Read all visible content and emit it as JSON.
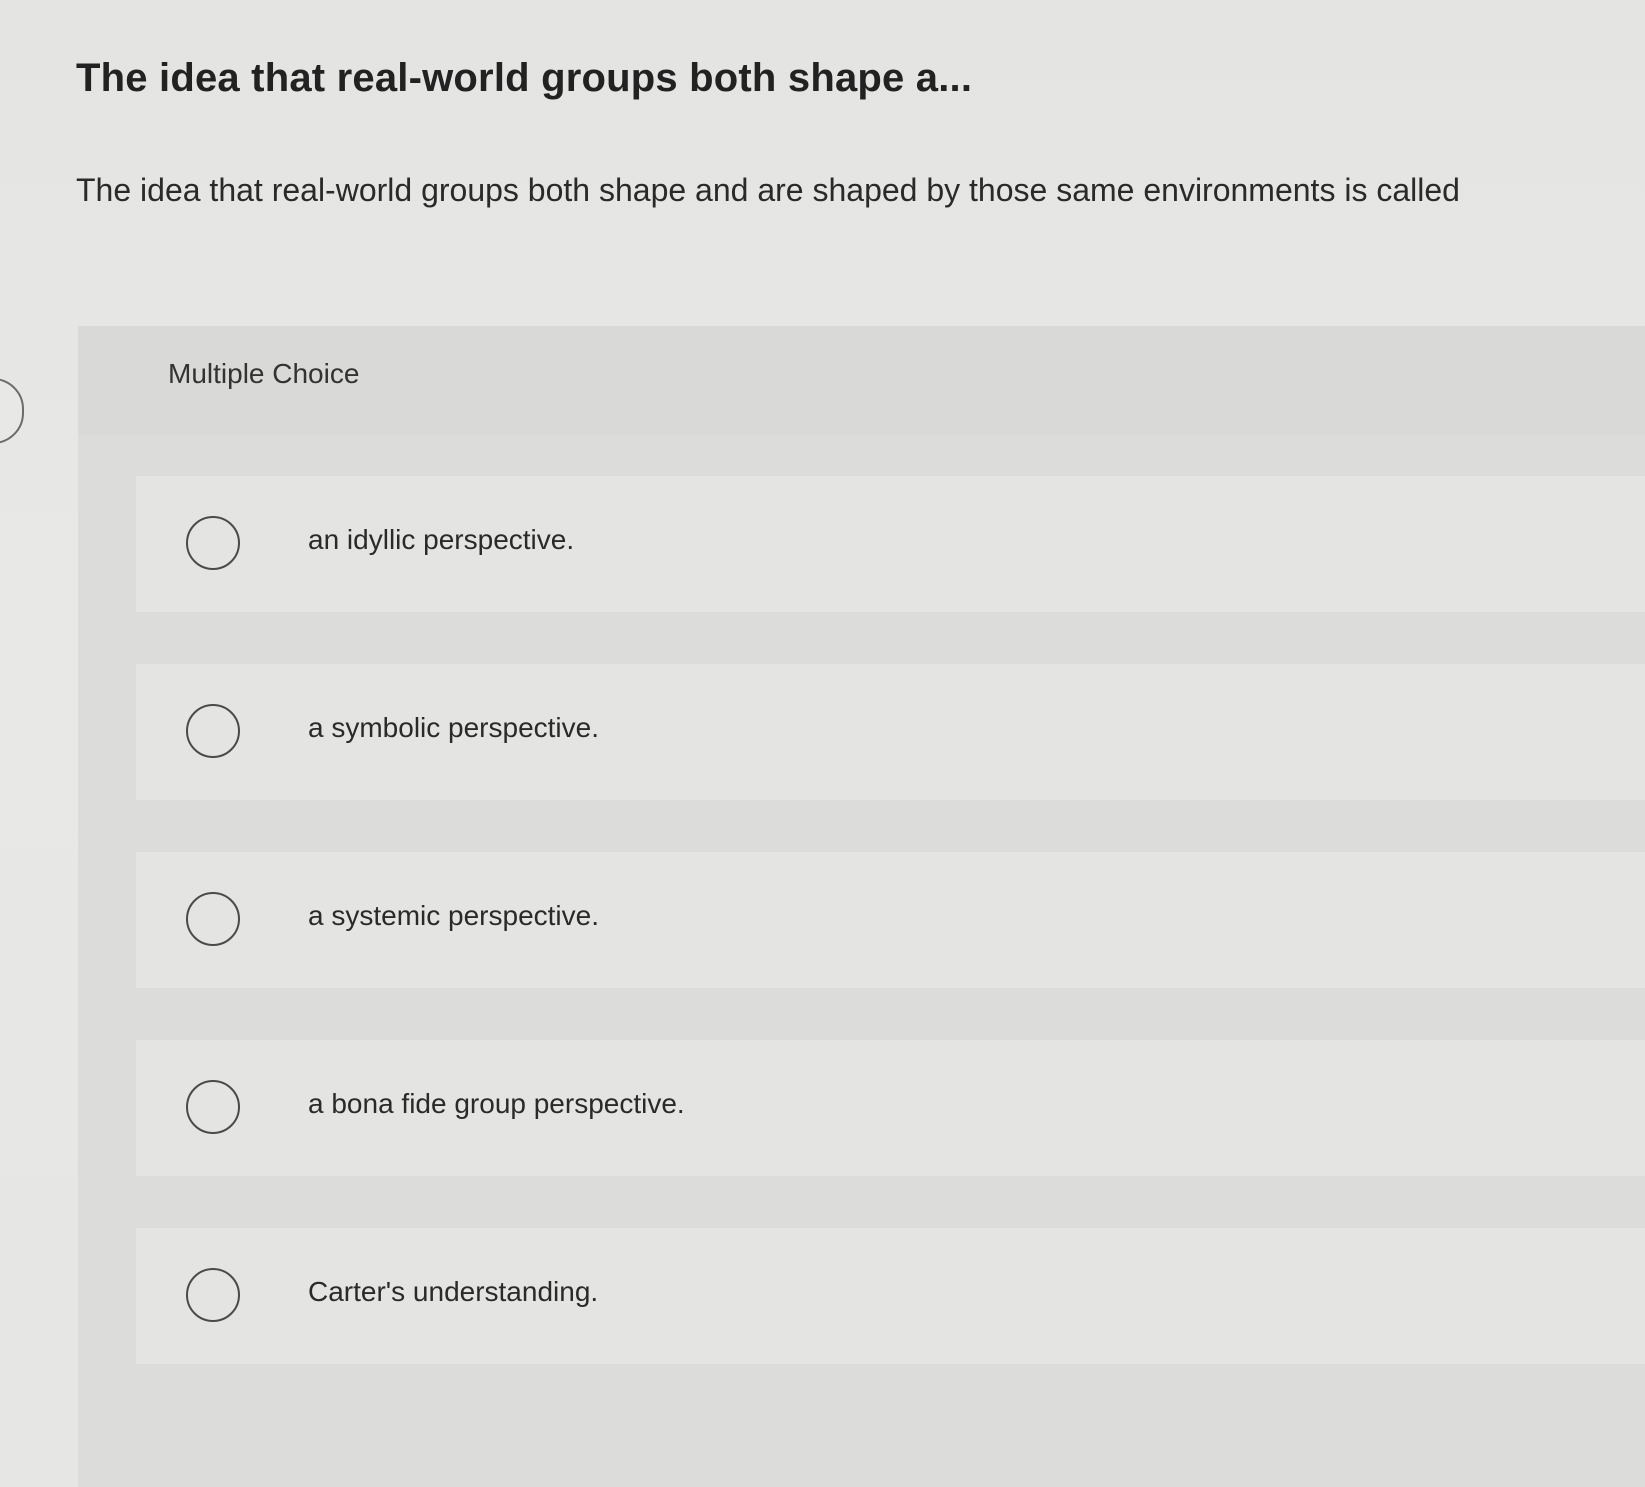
{
  "question": {
    "title": "The idea that real-world groups both shape a...",
    "prompt": "The idea that real-world groups both shape and are shaped by those same environments is called"
  },
  "multiple_choice": {
    "header": "Multiple Choice",
    "options": [
      {
        "label": "an idyllic perspective.",
        "selected": false
      },
      {
        "label": "a symbolic perspective.",
        "selected": false
      },
      {
        "label": "a systemic perspective.",
        "selected": false
      },
      {
        "label": "a bona fide group perspective.",
        "selected": false
      },
      {
        "label": "Carter's understanding.",
        "selected": false
      }
    ]
  },
  "colors": {
    "page_background": "#e6e6e4",
    "panel_background": "#dcdcda",
    "option_background": "#e4e4e2",
    "text": "#2a2a2a",
    "radio_border": "#4a4a4a"
  }
}
